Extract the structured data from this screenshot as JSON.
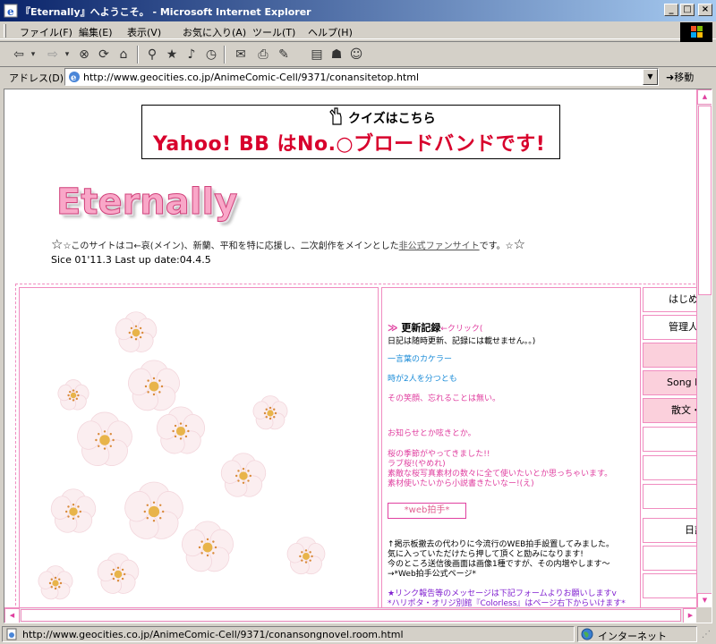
{
  "window": {
    "title": "『Eternally』へようこそ。 - Microsoft Internet Explorer",
    "min_label": "_",
    "max_label": "□",
    "close_label": "×"
  },
  "menu": [
    {
      "label": "ファイル(F)"
    },
    {
      "label": "編集(E)"
    },
    {
      "label": "表示(V)"
    },
    {
      "label": "お気に入り(A)"
    },
    {
      "label": "ツール(T)"
    },
    {
      "label": "ヘルプ(H)"
    }
  ],
  "toolbar": [
    {
      "icon": "back-icon",
      "glyph": "⇦"
    },
    {
      "icon": "back-dropdown-icon",
      "glyph": "▾"
    },
    {
      "icon": "forward-icon",
      "glyph": "⇨"
    },
    {
      "icon": "forward-dropdown-icon",
      "glyph": "▾"
    },
    {
      "icon": "stop-icon",
      "glyph": "⊗"
    },
    {
      "icon": "refresh-icon",
      "glyph": "⟳"
    },
    {
      "icon": "home-icon",
      "glyph": "⌂"
    },
    {
      "icon": "search-icon",
      "glyph": "⚲"
    },
    {
      "icon": "favorites-icon",
      "glyph": "★"
    },
    {
      "icon": "media-icon",
      "glyph": "♪"
    },
    {
      "icon": "history-icon",
      "glyph": "◷"
    },
    {
      "icon": "mail-icon",
      "glyph": "✉"
    },
    {
      "icon": "print-icon",
      "glyph": "⎙"
    },
    {
      "icon": "edit-icon",
      "glyph": "✎"
    },
    {
      "icon": "discuss-icon",
      "glyph": "▤"
    },
    {
      "icon": "research-icon",
      "glyph": "☗"
    },
    {
      "icon": "messenger-icon",
      "glyph": "☺"
    }
  ],
  "address": {
    "label": "アドレス(D)",
    "url": "http://www.geocities.co.jp/AnimeComic-Cell/9371/conansitetop.html",
    "go_label": "移動"
  },
  "ad": {
    "quiz": "クイズはこちら",
    "main": "Yahoo! BB はNo.○ブロードバンドです!"
  },
  "site": {
    "logo": "Eternally",
    "intro_star_left": "☆",
    "intro_before_link": "☆このサイトはコ←哀(メイン)、新蘭、平和を特に応援し、二次創作をメインとした",
    "intro_link": "非公式ファンサイト",
    "intro_after_link": "です。☆",
    "intro_star_right": "☆",
    "dates": "Sice 01'11.3 Last up date:04.4.5"
  },
  "news": {
    "heading_arrows": "≫",
    "heading": "更新記録",
    "click": "←クリック(",
    "diary_note": "日記は随時更新、記録には載せません。。)",
    "blue1": "一言葉のカケラー",
    "blue2": "時が2人を分つとも",
    "pink1": "その笑顔、忘れることは無い。",
    "pink2": "お知らせとか呟きとか。",
    "pink3": "桜の季節がやってきました!!",
    "pink4": "ラブ桜!(やめれ)",
    "pink5": "素敵な桜写真素材の数々に全て使いたいとか思っちゃいます。",
    "pink6": "素材使いたいから小説書きたいなー!(え)",
    "clap": "*web拍手*",
    "black1": "↑掲示板撤去の代わりに今流行のWEB拍手設置してみました。",
    "black2": "気に入っていただけたら押して頂くと励みになります!",
    "black3": "今のところ送信後画面は画像1種ですが、その内増やします〜",
    "black4": "→*Web拍手公式ページ*",
    "purple1": "★リンク報告等のメッセージは下記フォームよりお願いしますv",
    "purple2": "*ハリポタ・オリジ別館『Colorless』はページ右下からいけます*"
  },
  "nav": [
    {
      "label": "はじめに",
      "active": false
    },
    {
      "label": "管理人",
      "active": false
    },
    {
      "label": "",
      "active": true
    },
    {
      "label": "Song Novel",
      "active": true
    },
    {
      "label": "散文・詩",
      "active": true
    },
    {
      "label": "",
      "active": false
    },
    {
      "label": "",
      "active": false
    },
    {
      "label": "",
      "active": false
    },
    {
      "label": "日記",
      "active": false
    },
    {
      "label": "",
      "active": false
    },
    {
      "label": "",
      "active": false
    }
  ],
  "status": {
    "url": "http://www.geocities.co.jp/AnimeComic-Cell/9371/conansongnovel.room.html",
    "zone": "インターネット"
  },
  "colors": {
    "accent_pink": "#e040a0",
    "frame_pink": "#f08cc0",
    "ad_red": "#d8002c",
    "title_blue": "#0a246a"
  }
}
